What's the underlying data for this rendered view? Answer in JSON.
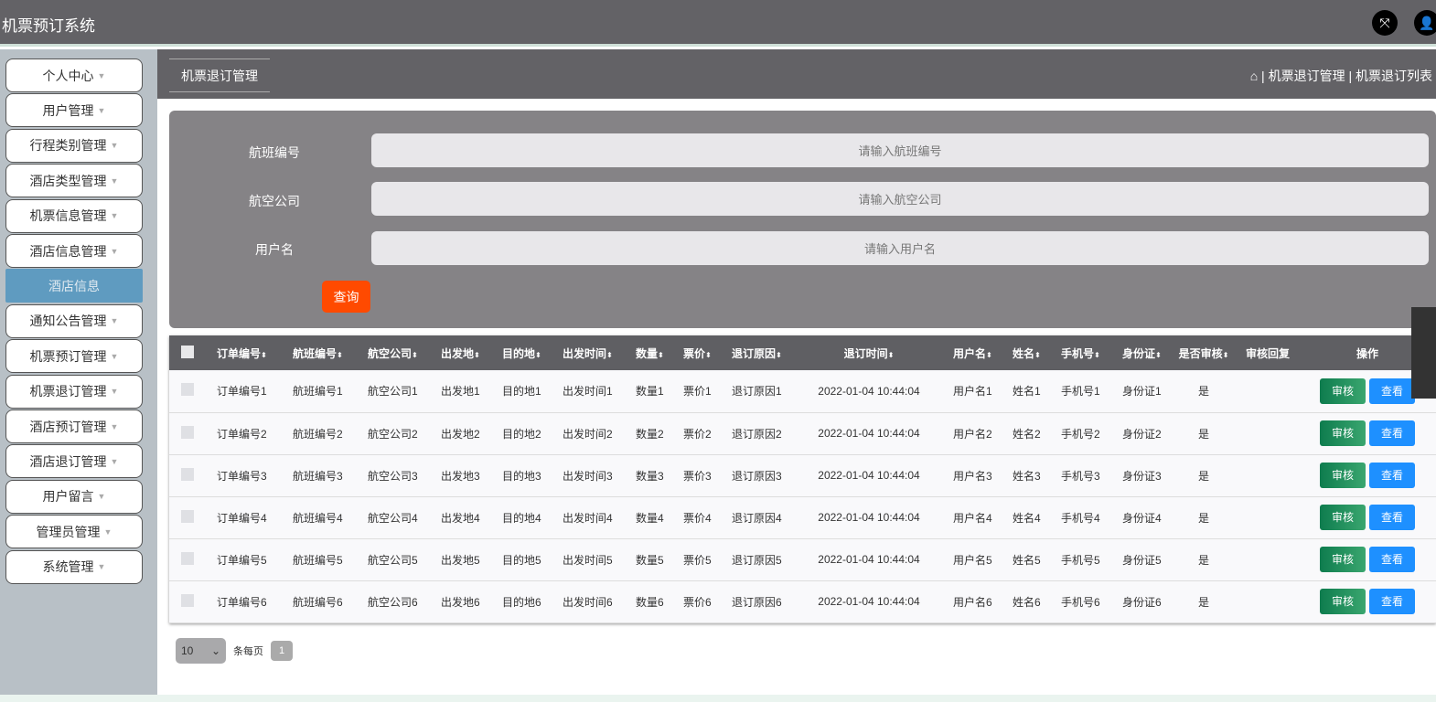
{
  "app": {
    "title": "机票预订系统"
  },
  "topbar": {
    "fullscreen_icon": "⤧",
    "user_icon": "👤"
  },
  "sidebar": {
    "items": [
      {
        "label": "个人中心"
      },
      {
        "label": "用户管理"
      },
      {
        "label": "行程类别管理"
      },
      {
        "label": "酒店类型管理"
      },
      {
        "label": "机票信息管理"
      },
      {
        "label": "酒店信息管理"
      },
      {
        "label": "酒店信息",
        "sub": true
      },
      {
        "label": "通知公告管理"
      },
      {
        "label": "机票预订管理"
      },
      {
        "label": "机票退订管理"
      },
      {
        "label": "酒店预订管理"
      },
      {
        "label": "酒店退订管理"
      },
      {
        "label": "用户留言"
      },
      {
        "label": "管理员管理"
      },
      {
        "label": "系统管理"
      }
    ]
  },
  "page": {
    "tab": "机票退订管理",
    "breadcrumb": "| 机票退订管理 | 机票退订列表"
  },
  "search": {
    "fields": [
      {
        "label": "航班编号",
        "placeholder": "请输入航班编号"
      },
      {
        "label": "航空公司",
        "placeholder": "请输入航空公司"
      },
      {
        "label": "用户名",
        "placeholder": "请输入用户名"
      }
    ],
    "query_label": "查询"
  },
  "table": {
    "columns": [
      "订单编号",
      "航班编号",
      "航空公司",
      "出发地",
      "目的地",
      "出发时间",
      "数量",
      "票价",
      "退订原因",
      "退订时间",
      "用户名",
      "姓名",
      "手机号",
      "身份证",
      "是否审核",
      "审核回复",
      "操作"
    ],
    "rows": [
      [
        "订单编号1",
        "航班编号1",
        "航空公司1",
        "出发地1",
        "目的地1",
        "出发时间1",
        "数量1",
        "票价1",
        "退订原因1",
        "2022-01-04 10:44:04",
        "用户名1",
        "姓名1",
        "手机号1",
        "身份证1",
        "是",
        ""
      ],
      [
        "订单编号2",
        "航班编号2",
        "航空公司2",
        "出发地2",
        "目的地2",
        "出发时间2",
        "数量2",
        "票价2",
        "退订原因2",
        "2022-01-04 10:44:04",
        "用户名2",
        "姓名2",
        "手机号2",
        "身份证2",
        "是",
        ""
      ],
      [
        "订单编号3",
        "航班编号3",
        "航空公司3",
        "出发地3",
        "目的地3",
        "出发时间3",
        "数量3",
        "票价3",
        "退订原因3",
        "2022-01-04 10:44:04",
        "用户名3",
        "姓名3",
        "手机号3",
        "身份证3",
        "是",
        ""
      ],
      [
        "订单编号4",
        "航班编号4",
        "航空公司4",
        "出发地4",
        "目的地4",
        "出发时间4",
        "数量4",
        "票价4",
        "退订原因4",
        "2022-01-04 10:44:04",
        "用户名4",
        "姓名4",
        "手机号4",
        "身份证4",
        "是",
        ""
      ],
      [
        "订单编号5",
        "航班编号5",
        "航空公司5",
        "出发地5",
        "目的地5",
        "出发时间5",
        "数量5",
        "票价5",
        "退订原因5",
        "2022-01-04 10:44:04",
        "用户名5",
        "姓名5",
        "手机号5",
        "身份证5",
        "是",
        ""
      ],
      [
        "订单编号6",
        "航班编号6",
        "航空公司6",
        "出发地6",
        "目的地6",
        "出发时间6",
        "数量6",
        "票价6",
        "退订原因6",
        "2022-01-04 10:44:04",
        "用户名6",
        "姓名6",
        "手机号6",
        "身份证6",
        "是",
        ""
      ]
    ],
    "audit_label": "审核",
    "view_label": "查看"
  },
  "pager": {
    "page_size": "10",
    "per_page_label": "条每页",
    "current_page": "1"
  }
}
